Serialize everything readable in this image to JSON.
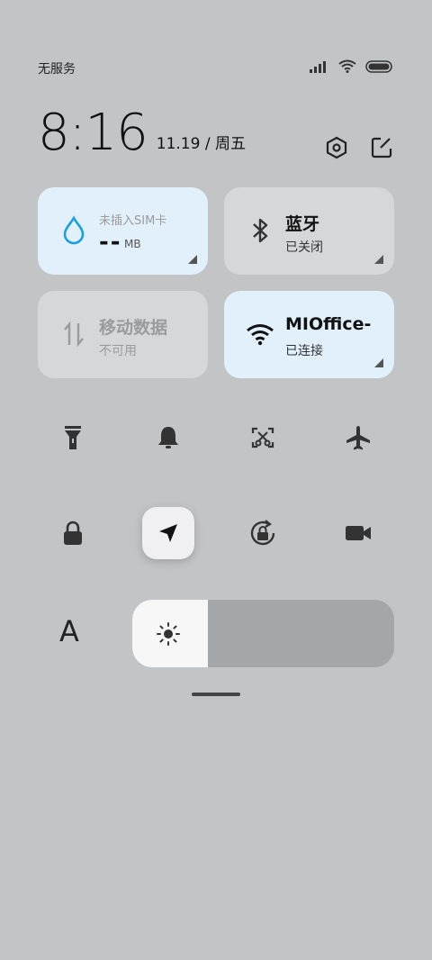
{
  "status_bar": {
    "carrier": "无服务",
    "icons": [
      "signal-icon",
      "wifi-icon",
      "battery-icon"
    ]
  },
  "clock": {
    "time": "8:16",
    "date": "11.19 / 周五"
  },
  "header_actions": [
    "settings-icon",
    "edit-icon"
  ],
  "tiles": {
    "sim": {
      "label": "未插入SIM卡",
      "value": "--",
      "unit": "MB",
      "icon": "water-drop-icon",
      "accent": "#1a9fe0"
    },
    "bluetooth": {
      "title": "蓝牙",
      "subtitle": "已关闭",
      "icon": "bluetooth-icon"
    },
    "mobile_data": {
      "title": "移动数据",
      "subtitle": "不可用",
      "icon": "data-arrows-icon"
    },
    "wifi": {
      "title": "MIOffice-",
      "subtitle": "已连接",
      "icon": "wifi-icon"
    }
  },
  "quick_toggles_row1": [
    "flashlight-icon",
    "bell-icon",
    "screenshot-icon",
    "airplane-icon"
  ],
  "quick_toggles_row2": [
    "lock-icon",
    "location-icon",
    "rotation-lock-icon",
    "video-camera-icon"
  ],
  "brightness": {
    "level": 0.29,
    "font_button": "A"
  },
  "colors": {
    "background": "#c3c4c6",
    "active_tile": "#e1f0fb",
    "inactive_tile": "#d6d7d9"
  }
}
